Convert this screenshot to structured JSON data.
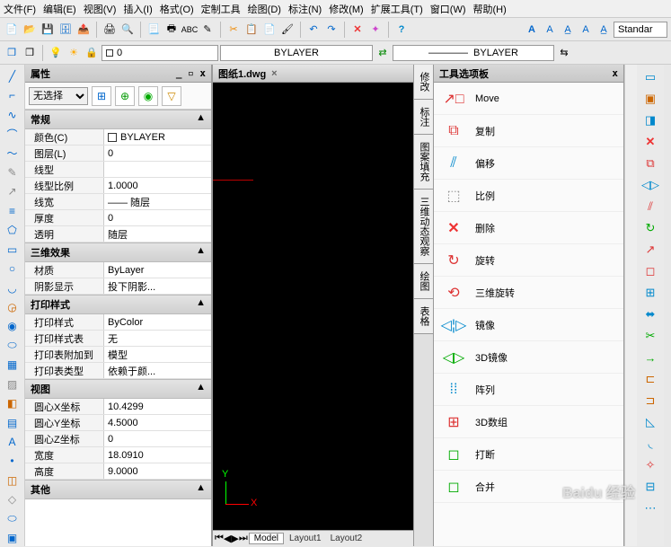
{
  "menu": [
    "文件(F)",
    "编辑(E)",
    "视图(V)",
    "插入(I)",
    "格式(O)",
    "定制工具",
    "绘图(D)",
    "标注(N)",
    "修改(M)",
    "扩展工具(T)",
    "窗口(W)",
    "帮助(H)"
  ],
  "toolbar2": {
    "layerlabel": "0",
    "bylayer1": "BYLAYER",
    "bylayer2": "BYLAYER",
    "stylebox": "Standar"
  },
  "prop": {
    "title": "属性",
    "nosel": "无选择",
    "sections": {
      "general": "常规",
      "color": {
        "k": "颜色(C)",
        "v": "BYLAYER"
      },
      "layer": {
        "k": "图层(L)",
        "v": "0"
      },
      "ltype": {
        "k": "线型",
        "v": ""
      },
      "ltscale": {
        "k": "线型比例",
        "v": "1.0000"
      },
      "lwidth": {
        "k": "线宽",
        "v": "—— 随层"
      },
      "thick": {
        "k": "厚度",
        "v": "0"
      },
      "trans": {
        "k": "透明",
        "v": "随层"
      },
      "effect3d": "三维效果",
      "material": {
        "k": "材质",
        "v": "ByLayer"
      },
      "shadow": {
        "k": "阴影显示",
        "v": "投下阴影..."
      },
      "printstyle": "打印样式",
      "pstyle": {
        "k": "打印样式",
        "v": "ByColor"
      },
      "ptable": {
        "k": "打印样式表",
        "v": "无"
      },
      "pattach": {
        "k": "打印表附加到",
        "v": "模型"
      },
      "ptype": {
        "k": "打印表类型",
        "v": "依赖于颜..."
      },
      "view": "视图",
      "cx": {
        "k": "圆心X坐标",
        "v": "10.4299"
      },
      "cy": {
        "k": "圆心Y坐标",
        "v": "4.5000"
      },
      "cz": {
        "k": "圆心Z坐标",
        "v": "0"
      },
      "w": {
        "k": "宽度",
        "v": "18.0910"
      },
      "h": {
        "k": "高度",
        "v": "9.0000"
      },
      "other": "其他"
    }
  },
  "canvas": {
    "tab": "图纸1.dwg",
    "model": "Model",
    "layout1": "Layout1",
    "layout2": "Layout2",
    "y": "Y",
    "x": "X"
  },
  "palette": {
    "title": "工具选项板",
    "items": [
      "Move",
      "复制",
      "偏移",
      "比例",
      "删除",
      "旋转",
      "三维旋转",
      "镜像",
      "3D镜像",
      "阵列",
      "3D数组",
      "打断",
      "合并"
    ]
  },
  "vtabs": [
    "修改",
    "标注",
    "图案填充",
    "三维动态观察",
    "绘图",
    "表格"
  ],
  "watermark": "Baidu 经验"
}
